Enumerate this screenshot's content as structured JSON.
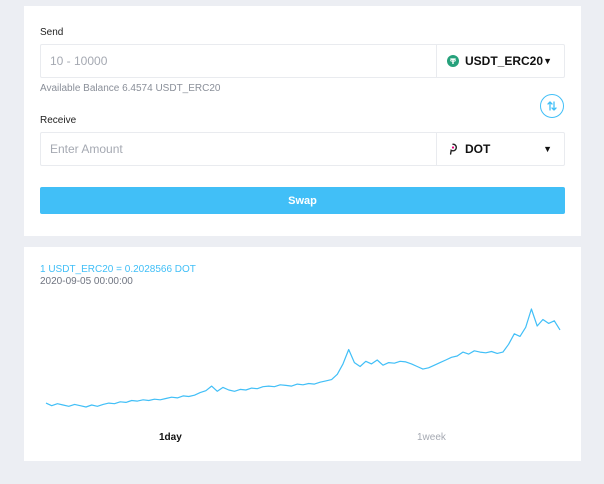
{
  "send": {
    "label": "Send",
    "placeholder": "10 - 10000",
    "value": "",
    "currency": "USDT_ERC20",
    "currency_icon": "tether-icon",
    "currency_color": "#26a17b",
    "balance": "Available Balance 6.4574 USDT_ERC20"
  },
  "receive": {
    "label": "Receive",
    "placeholder": "Enter Amount",
    "value": "",
    "currency": "DOT",
    "currency_icon": "polkadot-icon",
    "currency_color": "#e6007a"
  },
  "flip_icon": "swap-vertical-icon",
  "swap_button": "Swap",
  "accent_color": "#41bff7",
  "rate": {
    "text": "1 USDT_ERC20 = 0.2028566 DOT",
    "timestamp": "2020-09-05 00:00:00"
  },
  "ranges": [
    "1day",
    "1week"
  ],
  "selected_range": "1day",
  "chart_data": {
    "type": "line",
    "color": "#41bff7",
    "xlabel": "",
    "ylabel": "",
    "grid": false,
    "legend": "none",
    "axes_visible": false,
    "series": [
      {
        "values": [
          0.154,
          0.152,
          0.1535,
          0.1525,
          0.1515,
          0.153,
          0.152,
          0.151,
          0.1525,
          0.1515,
          0.153,
          0.154,
          0.1535,
          0.155,
          0.1545,
          0.156,
          0.1555,
          0.1565,
          0.156,
          0.157,
          0.1565,
          0.1575,
          0.1585,
          0.158,
          0.1595,
          0.159,
          0.16,
          0.162,
          0.1635,
          0.167,
          0.163,
          0.166,
          0.164,
          0.163,
          0.1645,
          0.164,
          0.1655,
          0.165,
          0.1665,
          0.167,
          0.1665,
          0.168,
          0.1675,
          0.167,
          0.1685,
          0.168,
          0.169,
          0.1685,
          0.17,
          0.171,
          0.172,
          0.176,
          0.184,
          0.195,
          0.185,
          0.182,
          0.186,
          0.184,
          0.187,
          0.183,
          0.185,
          0.1845,
          0.186,
          0.1855,
          0.184,
          0.182,
          0.18,
          0.181,
          0.183,
          0.185,
          0.187,
          0.189,
          0.19,
          0.193,
          0.1915,
          0.194,
          0.193,
          0.1925,
          0.1935,
          0.192,
          0.193,
          0.199,
          0.207,
          0.205,
          0.212,
          0.226,
          0.213,
          0.218,
          0.215,
          0.217,
          0.21
        ]
      }
    ]
  }
}
